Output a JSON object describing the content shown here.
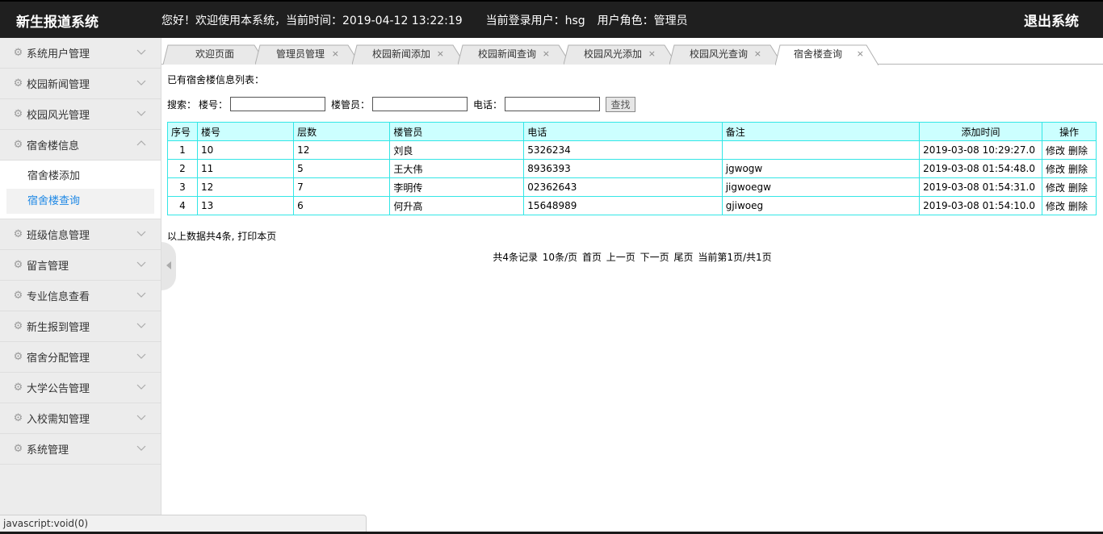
{
  "header": {
    "logo": "新生报道系统",
    "welcome": "您好！欢迎使用本系统，当前时间：",
    "time": "2019-04-12 13:22:19",
    "user_label": "当前登录用户：",
    "user": "hsg",
    "role_label": "用户角色：",
    "role": "管理员",
    "logout": "退出系统"
  },
  "sidebar": {
    "items": [
      {
        "label": "系统用户管理"
      },
      {
        "label": "校园新闻管理"
      },
      {
        "label": "校园风光管理"
      },
      {
        "label": "宿舍楼信息"
      },
      {
        "label": "班级信息管理"
      },
      {
        "label": "留言管理"
      },
      {
        "label": "专业信息查看"
      },
      {
        "label": "新生报到管理"
      },
      {
        "label": "宿舍分配管理"
      },
      {
        "label": "大学公告管理"
      },
      {
        "label": "入校需知管理"
      },
      {
        "label": "系统管理"
      }
    ],
    "submenu": [
      {
        "label": "宿舍楼添加"
      },
      {
        "label": "宿舍楼查询"
      }
    ]
  },
  "tabs": [
    {
      "label": "欢迎页面"
    },
    {
      "label": "管理员管理"
    },
    {
      "label": "校园新闻添加"
    },
    {
      "label": "校园新闻查询"
    },
    {
      "label": "校园风光添加"
    },
    {
      "label": "校园风光查询"
    },
    {
      "label": "宿舍楼查询"
    }
  ],
  "close_glyph": "×",
  "content": {
    "list_title": "已有宿舍楼信息列表：",
    "search": {
      "prefix": "搜索：",
      "building_label": "楼号：",
      "building_value": "",
      "manager_label": "楼管员：",
      "manager_value": "",
      "phone_label": "电话：",
      "phone_value": "",
      "button": "查找"
    },
    "table": {
      "headers": [
        "序号",
        "楼号",
        "层数",
        "楼管员",
        "电话",
        "备注",
        "添加时间",
        "操作"
      ],
      "rows": [
        {
          "no": "1",
          "building": "10",
          "floors": "12",
          "manager": "刘良",
          "phone": "5326234",
          "note": "",
          "time": "2019-03-08 10:29:27.0"
        },
        {
          "no": "2",
          "building": "11",
          "floors": "5",
          "manager": "王大伟",
          "phone": "8936393",
          "note": "jgwogw",
          "time": "2019-03-08 01:54:48.0"
        },
        {
          "no": "3",
          "building": "12",
          "floors": "7",
          "manager": "李明传",
          "phone": "02362643",
          "note": "jigwoegw",
          "time": "2019-03-08 01:54:31.0"
        },
        {
          "no": "4",
          "building": "13",
          "floors": "6",
          "manager": "何升高",
          "phone": "15648989",
          "note": "gjiwoeg",
          "time": "2019-03-08 01:54:10.0"
        }
      ],
      "edit": "修改",
      "delete": "删除"
    },
    "summary": "以上数据共4条, 打印本页",
    "pager": {
      "total": "共4条记录",
      "per_page": "10条/页",
      "first": "首页",
      "prev": "上一页",
      "next": "下一页",
      "last": "尾页",
      "current": "当前第1页/共1页"
    }
  },
  "statusbar": "javascript:void(0)",
  "colors": {
    "header_bg": "#1f1f1f",
    "sidebar_bg": "#ececec",
    "table_border": "#33e6e6",
    "table_header_bg": "#ccffff",
    "active_link": "#1e88e5"
  }
}
